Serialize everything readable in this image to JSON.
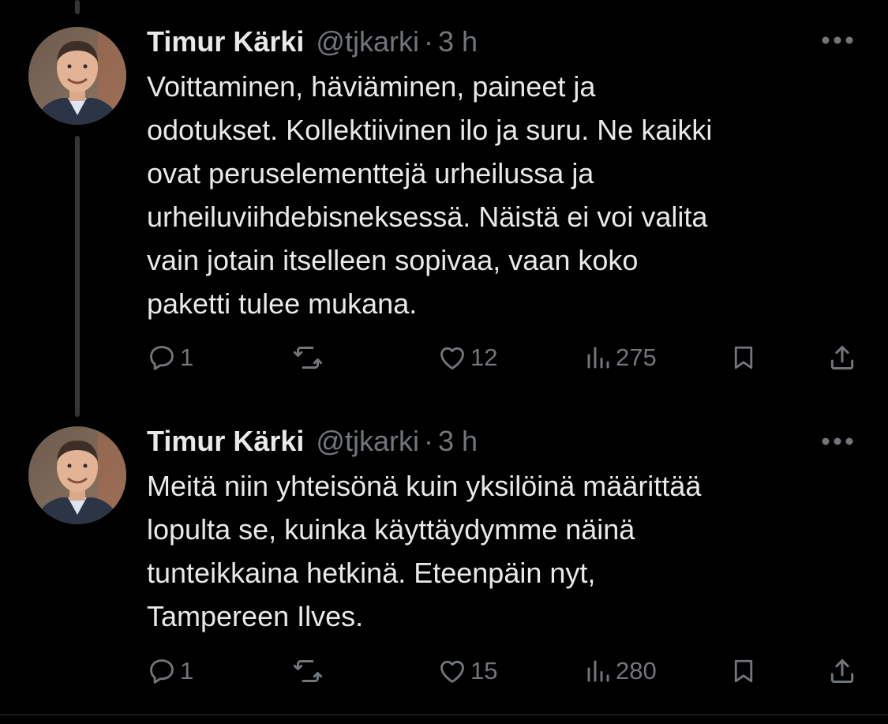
{
  "tweets": [
    {
      "author": {
        "name": "Timur Kärki",
        "handle": "@tjkarki"
      },
      "separator": "·",
      "time": "3 h",
      "text": "Voittaminen, häviäminen, paineet ja\nodotukset. Kollektiivinen ilo ja suru. Ne kaikki\novat peruselementtejä urheilussa ja\nurheiluviihdebisneksessä. Näistä ei voi valita\nvain jotain itselleen sopivaa, vaan koko\npaketti tulee mukana.",
      "stats": {
        "replies": "1",
        "likes": "12",
        "views": "275"
      }
    },
    {
      "author": {
        "name": "Timur Kärki",
        "handle": "@tjkarki"
      },
      "separator": "·",
      "time": "3 h",
      "text": "Meitä niin yhteisönä kuin yksilöinä määrittää\nlopulta se, kuinka käyttäydymme näinä\ntunteikkaina hetkinä. Eteenpäin nyt,\nTampereen Ilves.",
      "stats": {
        "replies": "1",
        "likes": "15",
        "views": "280"
      }
    }
  ],
  "icons": {
    "more": "more-horizontal-icon",
    "reply": "reply-bubble-icon",
    "retweet": "retweet-icon",
    "like": "heart-icon",
    "views": "views-bar-icon",
    "bookmark": "bookmark-icon",
    "share": "share-icon"
  },
  "colors": {
    "background": "#000000",
    "primary_text": "#e7e9ea",
    "secondary_text": "#71767b",
    "thread_line": "#333639"
  }
}
